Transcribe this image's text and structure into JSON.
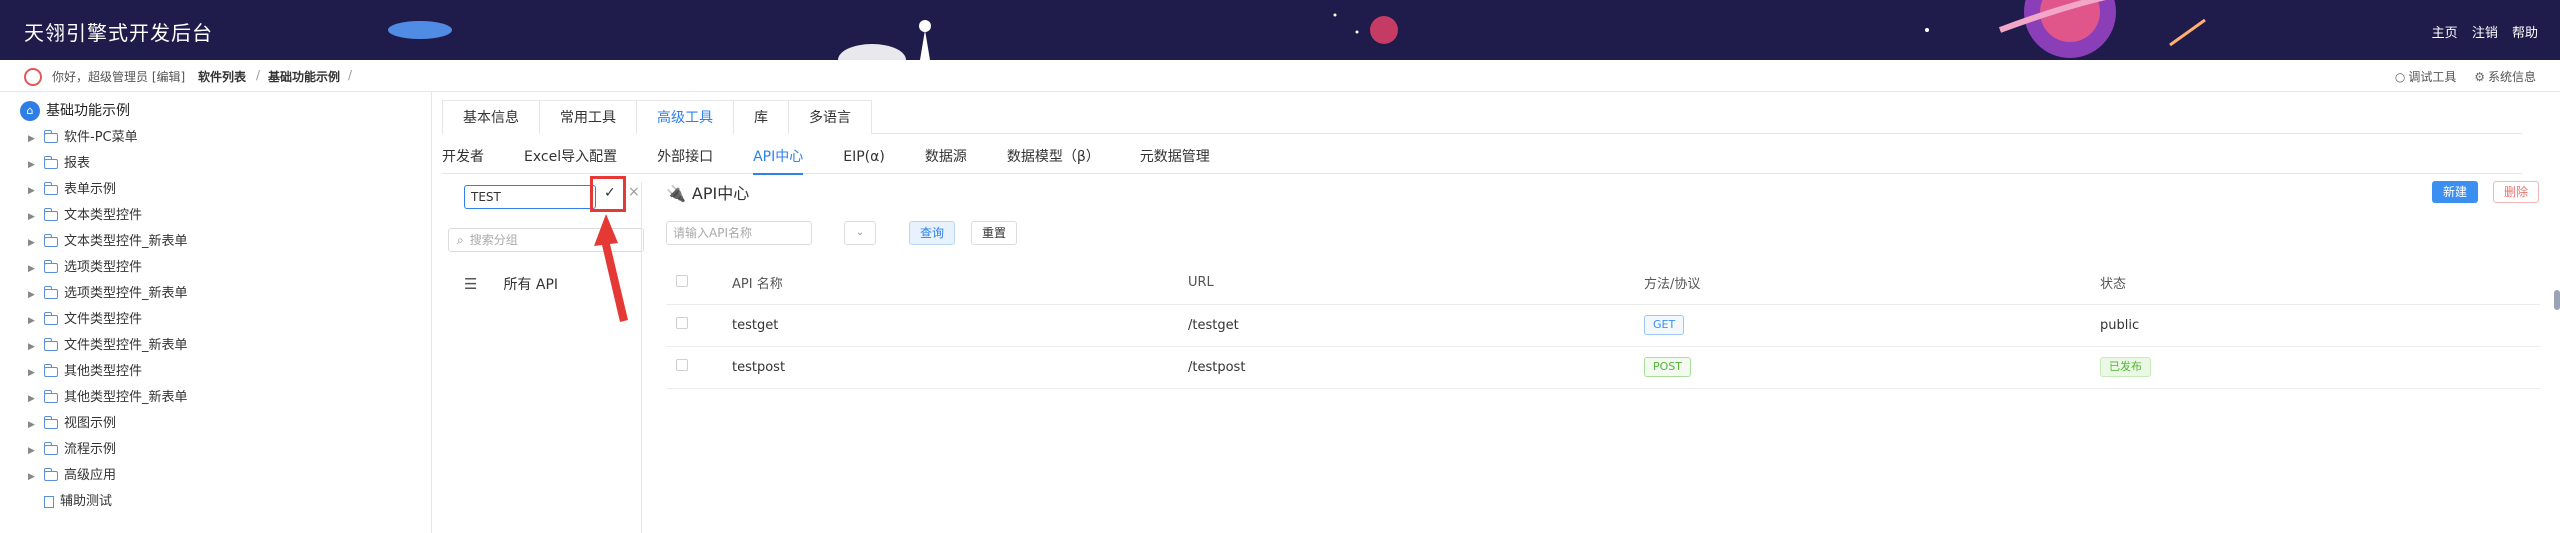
{
  "header": {
    "title": "天翎引擎式开发后台",
    "nav": [
      "主页",
      "注销",
      "帮助"
    ]
  },
  "breadcrumb": {
    "greeting": "你好，超级管理员 [编辑]",
    "items": [
      "软件列表",
      "基础功能示例"
    ],
    "separator": "/",
    "tools": [
      "调试工具",
      "系统信息"
    ]
  },
  "tree": {
    "root": "基础功能示例",
    "items": [
      "软件-PC菜单",
      "报表",
      "表单示例",
      "文本类型控件",
      "文本类型控件_新表单",
      "选项类型控件",
      "选项类型控件_新表单",
      "文件类型控件",
      "文件类型控件_新表单",
      "其他类型控件",
      "其他类型控件_新表单",
      "视图示例",
      "流程示例",
      "高级应用"
    ],
    "leaf": "辅助测试"
  },
  "tabs_primary": [
    "基本信息",
    "常用工具",
    "高级工具",
    "库",
    "多语言"
  ],
  "tabs_primary_active": "高级工具",
  "tabs_secondary": [
    "开发者",
    "Excel导入配置",
    "外部接口",
    "API中心",
    "EIP(α)",
    "数据源",
    "数据模型（β）",
    "元数据管理"
  ],
  "tabs_secondary_active": "API中心",
  "group_panel": {
    "name_value": "TEST",
    "confirm_symbol": "✓",
    "cancel_symbol": "×",
    "search_placeholder": "搜索分组",
    "all_api_label": "所有 API"
  },
  "api_panel": {
    "title": "API中心",
    "new_label": "新建",
    "delete_label": "删除",
    "search_placeholder": "请输入API名称",
    "query_label": "查询",
    "reset_label": "重置",
    "columns": [
      "API 名称",
      "URL",
      "方法/协议",
      "状态"
    ],
    "rows": [
      {
        "name": "testget",
        "url": "/testget",
        "method": "GET",
        "status": "public"
      },
      {
        "name": "testpost",
        "url": "/testpost",
        "method": "POST",
        "status": "已发布"
      }
    ]
  },
  "colors": {
    "header_bg": "#1f1b4a",
    "accent": "#2f80ed",
    "highlight": "#e53935"
  }
}
